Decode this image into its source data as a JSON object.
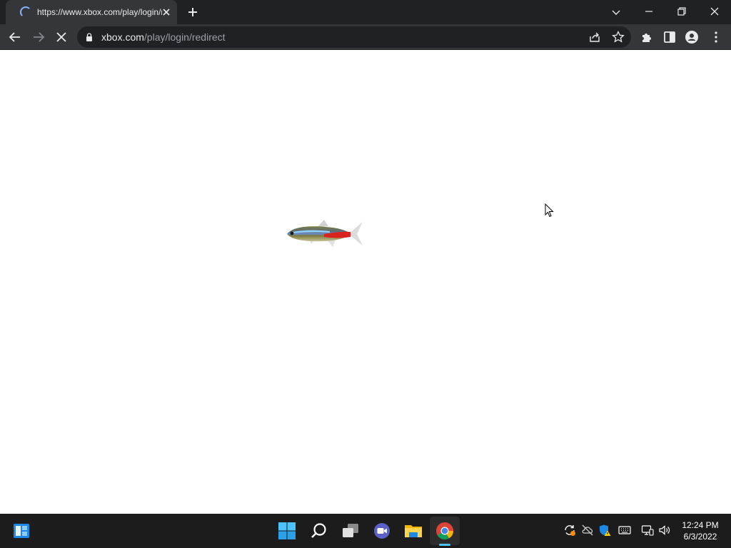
{
  "browser": {
    "tab": {
      "title": "https://www.xbox.com/play/login/redirect",
      "loading": true
    },
    "address_bar": {
      "host": "xbox.com",
      "path": "/play/login/redirect"
    },
    "icons": {
      "back": "back-arrow-icon",
      "forward": "forward-arrow-icon",
      "stop": "stop-loading-icon",
      "lock": "lock-icon",
      "share": "share-icon",
      "bookmark": "star-icon",
      "extensions": "puzzle-icon",
      "side_panel": "side-panel-icon",
      "profile": "profile-icon",
      "menu": "kebab-menu-icon"
    },
    "colors": {
      "frame": "#202124",
      "toolbar": "#35363a",
      "text": "#e8eaed",
      "muted": "#9aa0a6"
    }
  },
  "page": {
    "image": "neon-tetra-fish-image"
  },
  "taskbar": {
    "apps": [
      "widgets",
      "start",
      "search",
      "task-view",
      "teams-chat",
      "file-explorer",
      "chrome"
    ],
    "active_app": "chrome",
    "tray": [
      "update-icon",
      "onedrive-offline-icon",
      "security-warning-icon",
      "keyboard-icon",
      "network-icon",
      "volume-icon"
    ],
    "clock": {
      "time": "12:24 PM",
      "date": "6/3/2022"
    },
    "accent": "#4cc2ff"
  }
}
